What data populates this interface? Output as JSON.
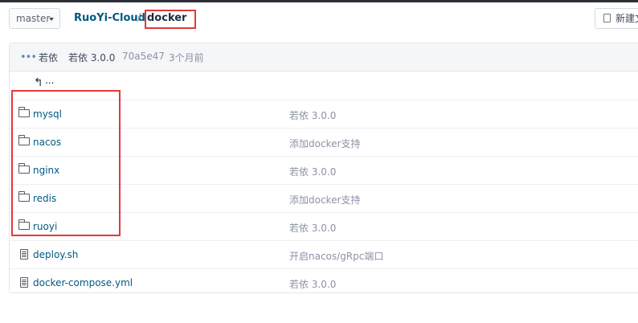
{
  "branch": {
    "label": "master"
  },
  "breadcrumb": {
    "repo": "RuoYi-Cloud",
    "separator": "/",
    "current": "docker"
  },
  "new_button": {
    "label": "新建文件"
  },
  "commit": {
    "author": "若依",
    "message": "若依 3.0.0",
    "sha": "70a5e47",
    "time": "3个月前"
  },
  "parent_link": {
    "label": "..."
  },
  "files": [
    {
      "type": "folder",
      "name": "mysql",
      "message": "若依 3.0.0"
    },
    {
      "type": "folder",
      "name": "nacos",
      "message": "添加docker支持"
    },
    {
      "type": "folder",
      "name": "nginx",
      "message": "若依 3.0.0"
    },
    {
      "type": "folder",
      "name": "redis",
      "message": "添加docker支持"
    },
    {
      "type": "folder",
      "name": "ruoyi",
      "message": "若依 3.0.0"
    },
    {
      "type": "file",
      "name": "deploy.sh",
      "message": "开启nacos/gRpc端口"
    },
    {
      "type": "file",
      "name": "docker-compose.yml",
      "message": "若依 3.0.0"
    }
  ],
  "colors": {
    "link": "#005980",
    "highlight": "#e03a3a",
    "muted": "#8c92a4"
  }
}
